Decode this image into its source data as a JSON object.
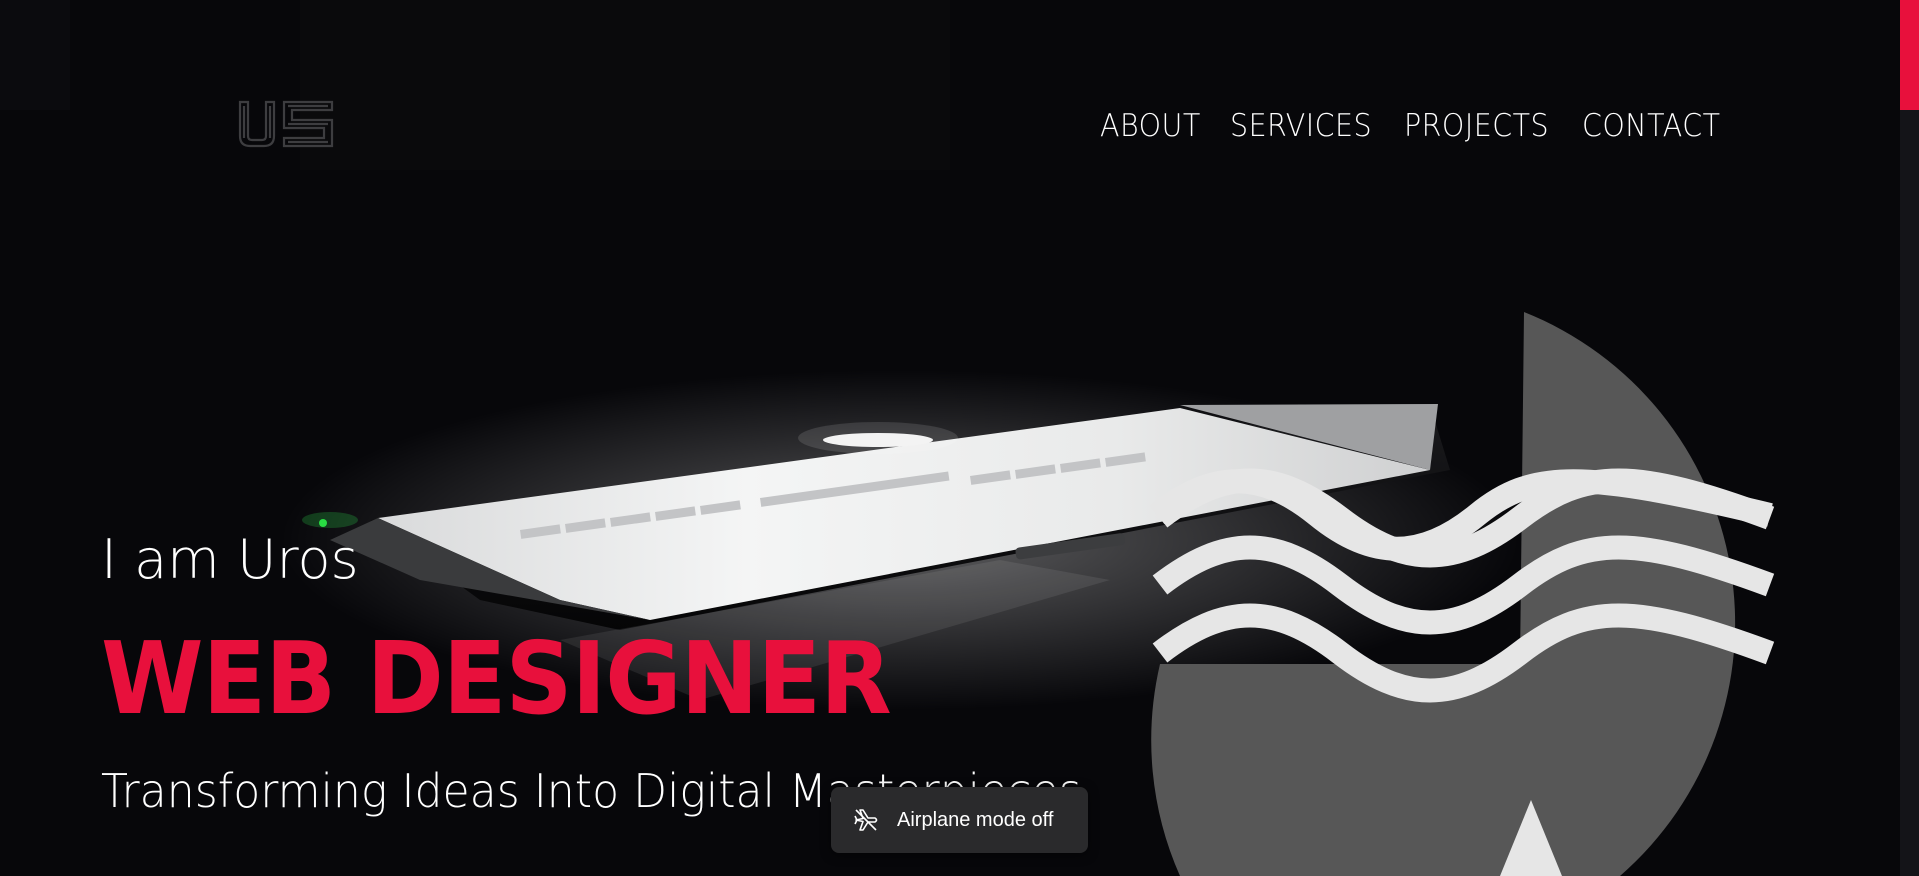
{
  "logo": {
    "text": "US"
  },
  "nav": {
    "about": "ABOUT",
    "services": "SERVICES",
    "projects": "PROJECTS",
    "contact": "CONTACT"
  },
  "hero": {
    "intro": "I am Uros",
    "headline": "WEB DESIGNER",
    "tagline": "Transforming Ideas Into Digital Masterpieces"
  },
  "toast": {
    "icon": "airplane-icon",
    "text": "Airplane mode off"
  },
  "colors": {
    "accent": "#e8103c",
    "background": "#07070a",
    "graphic": "#575757",
    "waves": "#e6e6e6",
    "toast": "#2a2a2c"
  }
}
